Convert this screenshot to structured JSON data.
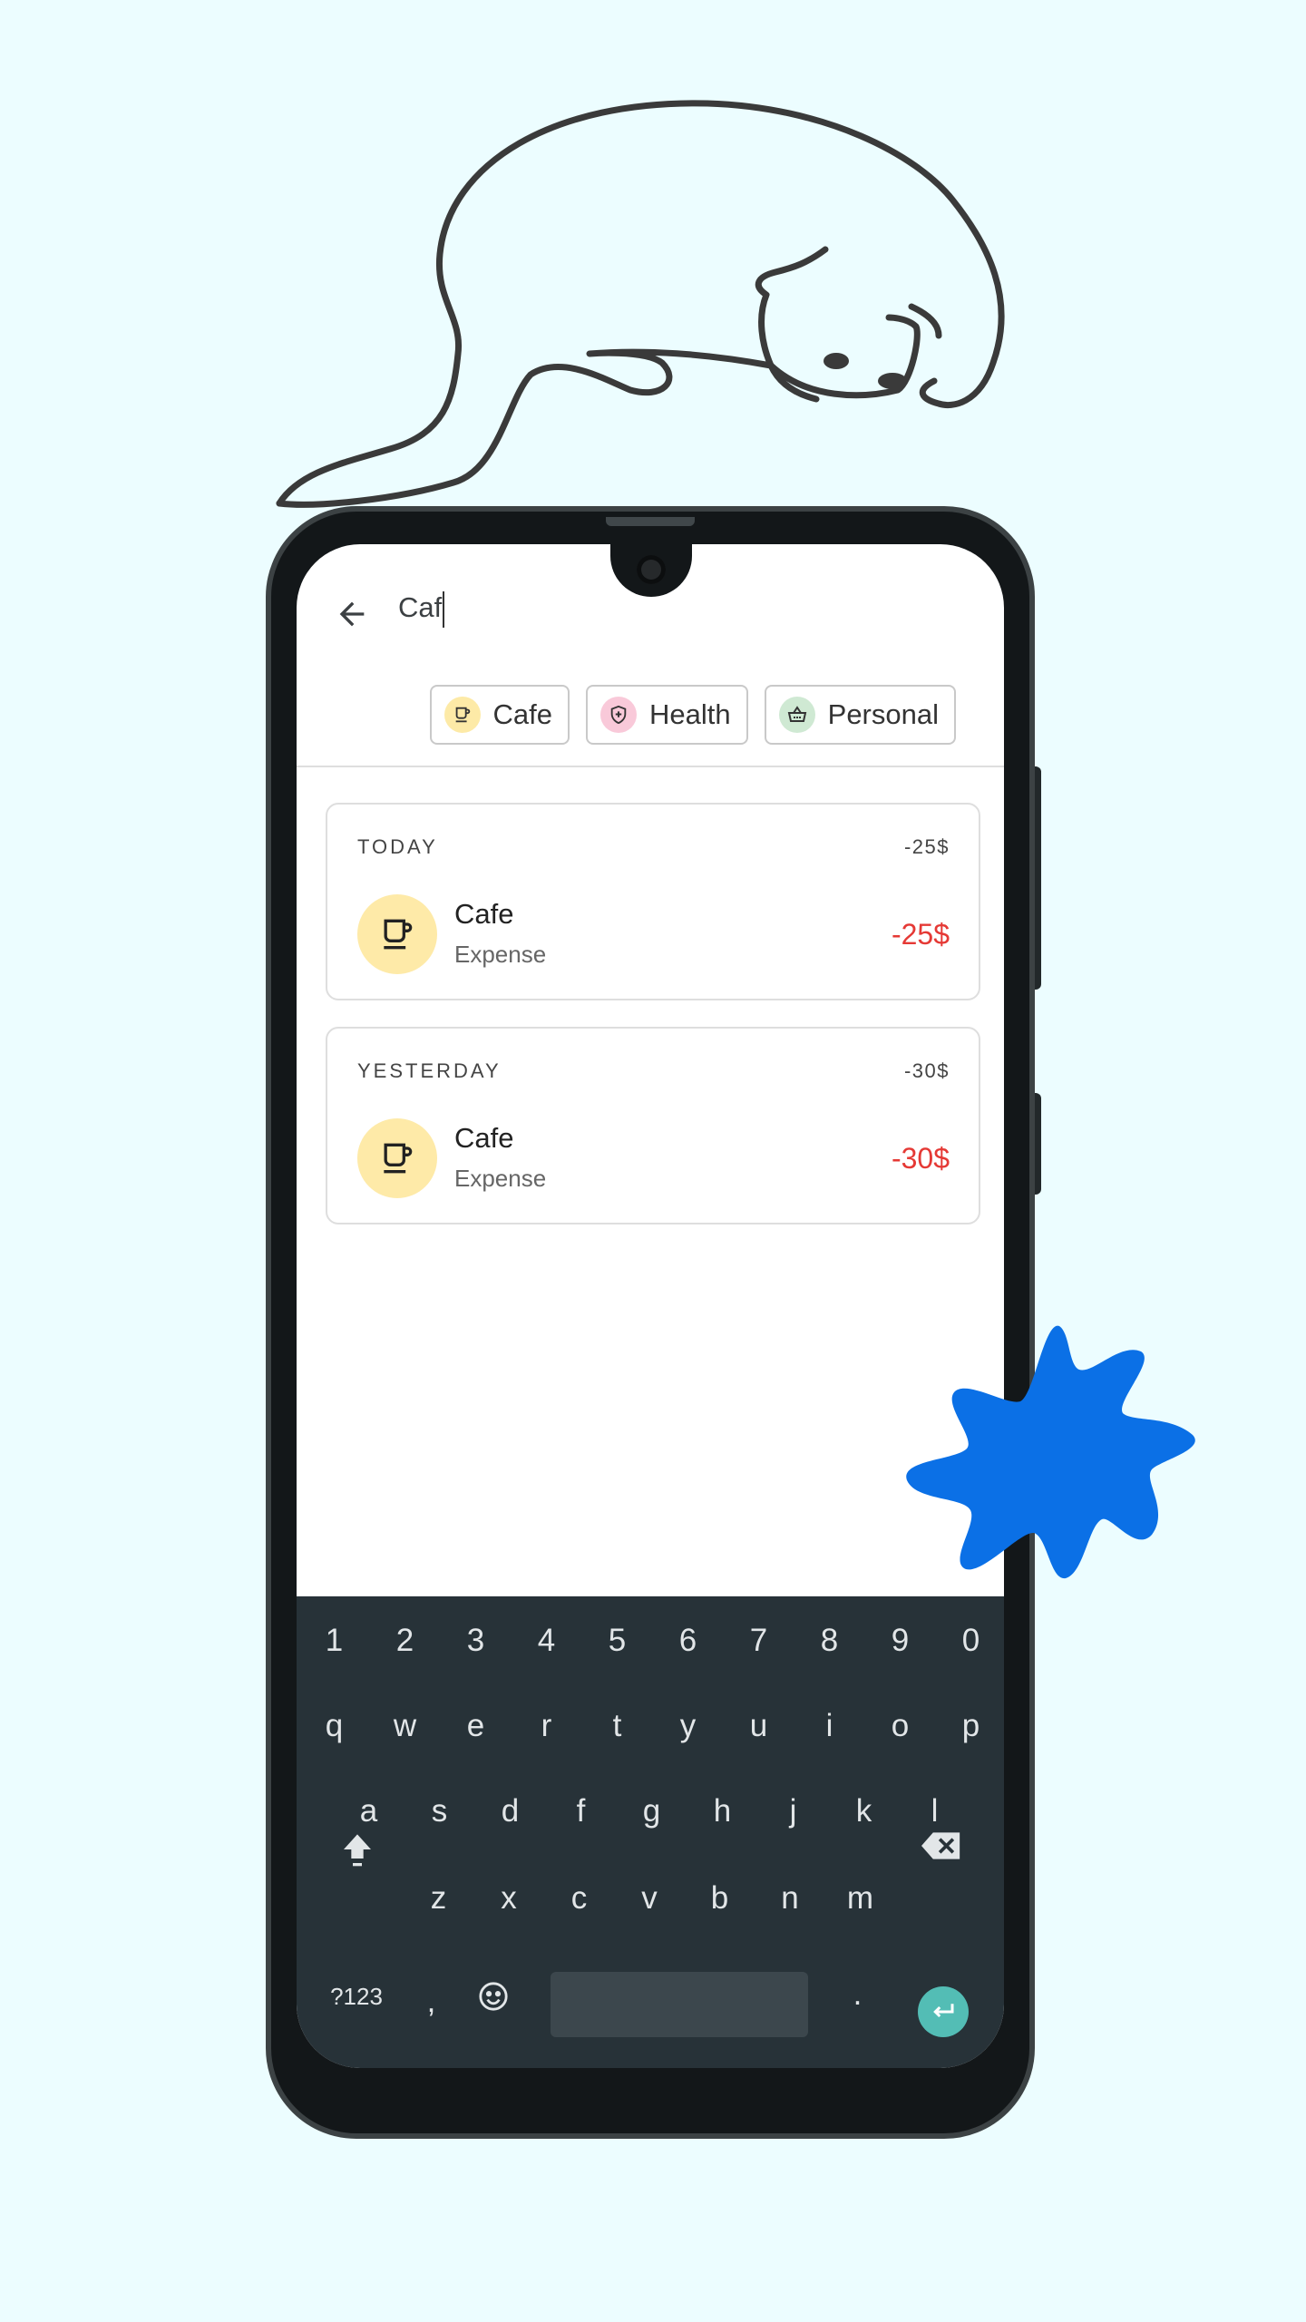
{
  "search": {
    "query": "Caf"
  },
  "chips": [
    {
      "label": "Cafe",
      "icon": "coffee-cup-icon",
      "color": "#fdeaa7"
    },
    {
      "label": "Health",
      "icon": "shield-icon",
      "color": "#f9c9d9"
    },
    {
      "label": "Personal",
      "icon": "basket-icon",
      "color": "#cfe9d3"
    }
  ],
  "groups": [
    {
      "date": "TODAY",
      "total": "-25$",
      "items": [
        {
          "name": "Cafe",
          "type": "Expense",
          "amount": "-25$",
          "icon": "coffee-cup-icon"
        }
      ]
    },
    {
      "date": "YESTERDAY",
      "total": "-30$",
      "items": [
        {
          "name": "Cafe",
          "type": "Expense",
          "amount": "-30$",
          "icon": "coffee-cup-icon"
        }
      ]
    }
  ],
  "keyboard": {
    "row1": [
      "1",
      "2",
      "3",
      "4",
      "5",
      "6",
      "7",
      "8",
      "9",
      "0"
    ],
    "row2": [
      "q",
      "w",
      "e",
      "r",
      "t",
      "y",
      "u",
      "i",
      "o",
      "p"
    ],
    "row3": [
      "a",
      "s",
      "d",
      "f",
      "g",
      "h",
      "j",
      "k",
      "l"
    ],
    "row4": [
      "z",
      "x",
      "c",
      "v",
      "b",
      "n",
      "m"
    ],
    "symbols_key": "?123",
    "comma_key": ",",
    "period_key": "."
  },
  "colors": {
    "accent_red": "#e53935",
    "keyboard_bg": "#273238",
    "enter_key": "#53bdb5",
    "background": "#ecfdff",
    "splash": "#0b70e6"
  }
}
